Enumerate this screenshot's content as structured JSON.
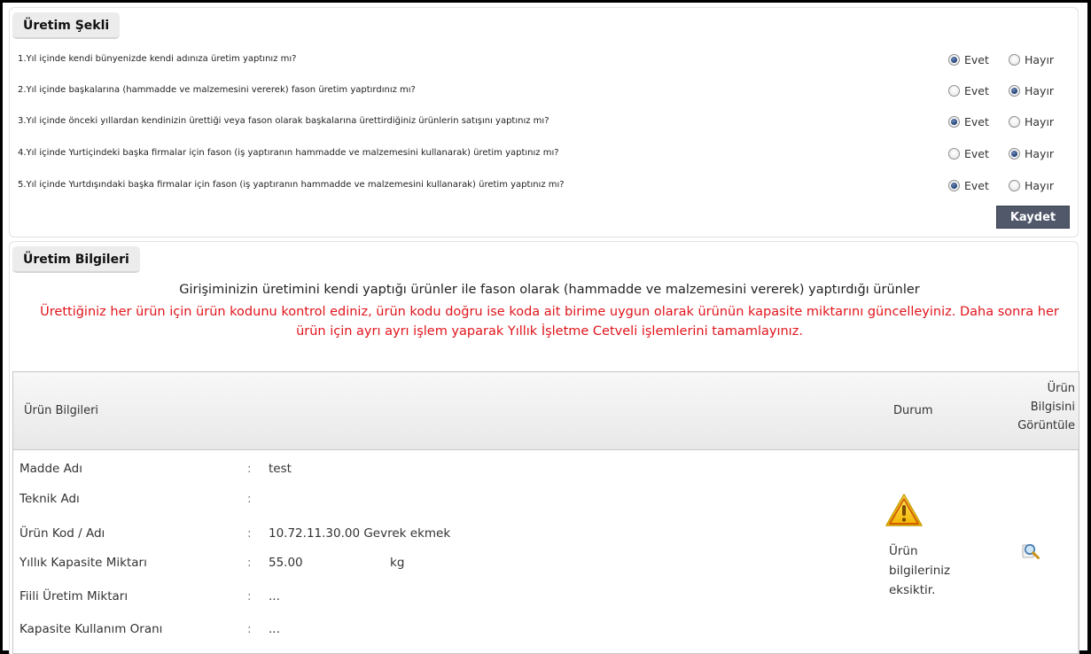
{
  "uretim_sekli": {
    "title": "Üretim Şekli",
    "yes_label": "Evet",
    "no_label": "Hayır",
    "questions": [
      {
        "text": "1.Yıl içinde kendi bünyenizde kendi adınıza üretim yaptınız mı?",
        "answer": "Evet"
      },
      {
        "text": "2.Yıl içinde başkalarına (hammadde ve malzemesini vererek) fason üretim yaptırdınız mı?",
        "answer": "Hayır"
      },
      {
        "text": "3.Yıl içinde önceki yıllardan kendinizin ürettiği veya fason olarak başkalarına ürettirdiğiniz ürünlerin satışını yaptınız mı?",
        "answer": "Evet"
      },
      {
        "text": "4.Yıl içinde Yurtiçindeki başka firmalar için fason (iş yaptıranın hammadde ve malzemesini kullanarak) üretim yaptınız mı?",
        "answer": "Hayır"
      },
      {
        "text": "5.Yıl içinde Yurtdışındaki başka firmalar için fason (iş yaptıranın hammadde ve malzemesini kullanarak) üretim yaptınız mı?",
        "answer": "Evet"
      }
    ],
    "save_label": "Kaydet"
  },
  "uretim_bilgileri": {
    "title": "Üretim Bilgileri",
    "desc_black": "Girişiminizin üretimini kendi yaptığı ürünler ile fason olarak (hammadde ve malzemesini vererek) yaptırdığı ürünler",
    "desc_red": "Ürettiğiniz her ürün için ürün kodunu kontrol ediniz, ürün kodu doğru ise koda ait birime uygun olarak ürünün kapasite miktarını güncelleyiniz. Daha sonra her ürün için ayrı ayrı işlem yaparak Yıllık İşletme Cetveli işlemlerini tamamlayınız.",
    "table": {
      "col_info": "Ürün Bilgileri",
      "col_status": "Durum",
      "col_view_1": "Ürün",
      "col_view_2": "Bilgisini",
      "col_view_3": "Görüntüle",
      "rows": [
        {
          "label": "Madde Adı",
          "colon": ":",
          "value": "test",
          "unit": ""
        },
        {
          "label": "Teknik Adı",
          "colon": ":",
          "value": "",
          "unit": ""
        },
        {
          "label": "Ürün Kod / Adı",
          "colon": ":",
          "value": "10.72.11.30.00 Gevrek ekmek",
          "unit": ""
        },
        {
          "label": "Yıllık Kapasite Miktarı",
          "colon": ":",
          "value": "55.00",
          "unit": "kg"
        },
        {
          "label": "Fiili Üretim Miktarı",
          "colon": ":",
          "value": "...",
          "unit": ""
        },
        {
          "label": "Kapasite Kullanım Oranı",
          "colon": ":",
          "value": "...",
          "unit": ""
        }
      ],
      "status_line1": "Ürün",
      "status_line2": "bilgileriniz",
      "status_line3": "eksiktir.",
      "status_icon": "warning-icon",
      "view_icon": "magnifier-icon",
      "warning_color": "#f5c400"
    }
  }
}
